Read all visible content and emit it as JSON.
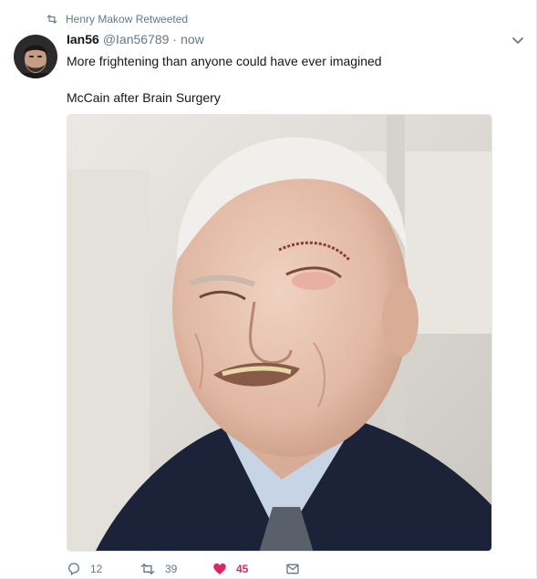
{
  "retweet_context": {
    "text": "Henry Makow Retweeted",
    "icon": "retweet-icon"
  },
  "author": {
    "display_name": "Ian56",
    "handle": "@Ian56789",
    "separator": "·",
    "time": "now",
    "avatar_icon": "avatar"
  },
  "tweet": {
    "lines": [
      "More frightening than anyone could have ever imagined",
      "McCain after Brain Surgery"
    ],
    "media_icon": "photo"
  },
  "actions": {
    "reply_count": "12",
    "retweet_count": "39",
    "like_count": "45",
    "liked": true
  },
  "colors": {
    "secondary_text": "#657786",
    "like": "#e0245e",
    "border": "#e6ecf0"
  }
}
